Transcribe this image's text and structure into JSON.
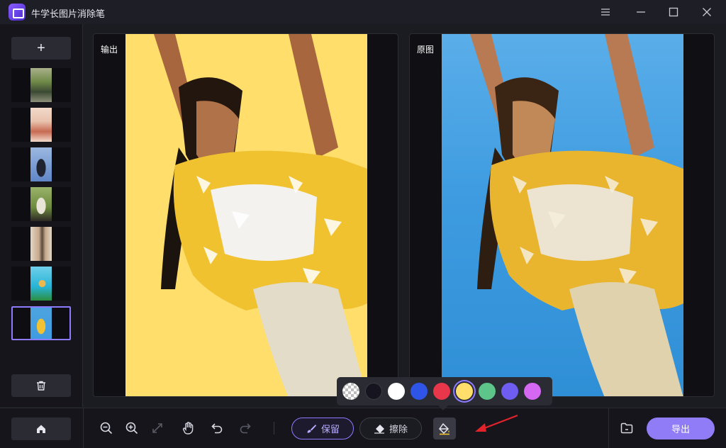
{
  "window": {
    "title": "牛学长图片消除笔",
    "controls": [
      "menu-icon",
      "minimize-icon",
      "maximize-icon",
      "close-icon"
    ]
  },
  "sidebar": {
    "add_label": "+",
    "thumbnails": [
      {
        "name": "thumb-car-road",
        "colors": [
          "#6f8a48",
          "#3b4a33",
          "#a9b08a"
        ]
      },
      {
        "name": "thumb-woman-pink",
        "colors": [
          "#e8c2ad",
          "#c86a52",
          "#f2d9c9"
        ]
      },
      {
        "name": "thumb-bird-sky",
        "colors": [
          "#5f86c8",
          "#1f2430",
          "#9cb8e0"
        ]
      },
      {
        "name": "thumb-goat-grass",
        "colors": [
          "#6c8a3d",
          "#e9e4d8",
          "#2d2a26"
        ]
      },
      {
        "name": "thumb-person-room",
        "colors": [
          "#c4a88b",
          "#5b4a3e",
          "#e3d6c4"
        ]
      },
      {
        "name": "thumb-kid-pool",
        "colors": [
          "#27b3d6",
          "#f0b84a",
          "#2b8f3f"
        ]
      },
      {
        "name": "thumb-woman-yellow",
        "colors": [
          "#4da3df",
          "#f2c233",
          "#f1eee6"
        ],
        "selected": true
      }
    ],
    "trash_icon": "trash-icon"
  },
  "panels": {
    "output_label": "输出",
    "original_label": "原图",
    "output_background": "#FFDE6B",
    "original_background": "#3E9BE0"
  },
  "palette": {
    "colors": [
      "transparent",
      "#15141f",
      "#ffffff",
      "#2f55e8",
      "#e8364a",
      "#ffde6b",
      "#5ec58a",
      "#6f5cf0",
      "#d468f2"
    ],
    "selected_index": 5
  },
  "toolbar": {
    "home_icon": "home-icon",
    "tools": [
      "zoom-out-icon",
      "zoom-in-icon",
      "fit-screen-icon",
      "hand-icon",
      "undo-icon",
      "redo-icon"
    ],
    "keep_label": "保留",
    "erase_label": "擦除",
    "fill_icon": "paint-bucket-icon",
    "folder_icon": "folder-icon",
    "export_label": "导出",
    "accent": "#8F7CF6"
  }
}
